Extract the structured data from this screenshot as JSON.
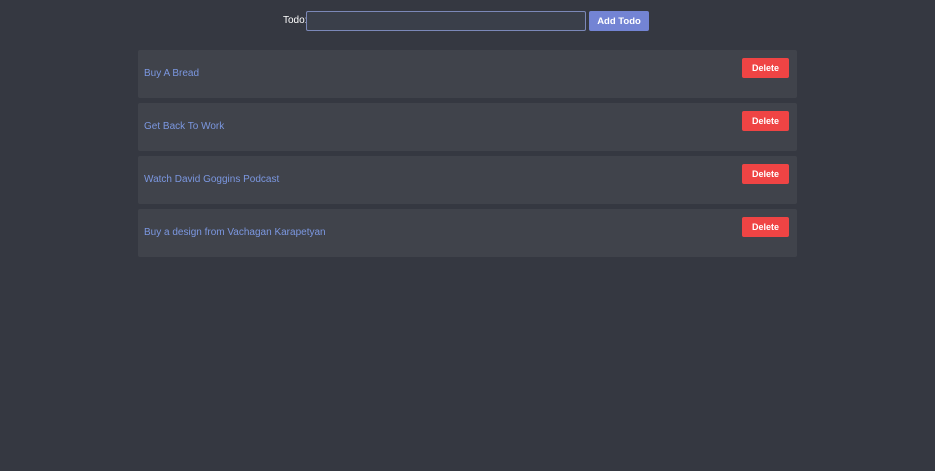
{
  "form": {
    "label": "Todo:",
    "input_value": "",
    "input_placeholder": "",
    "add_button_label": "Add Todo"
  },
  "todos": [
    {
      "text": "Buy A Bread",
      "delete_label": "Delete"
    },
    {
      "text": "Get Back To Work",
      "delete_label": "Delete"
    },
    {
      "text": "Watch David Goggins Podcast",
      "delete_label": "Delete"
    },
    {
      "text": "Buy a design from Vachagan Karapetyan",
      "delete_label": "Delete"
    }
  ],
  "colors": {
    "background": "#353841",
    "card": "#40434b",
    "accent": "#7384d4",
    "todo_text": "#7b97e0",
    "danger": "#ef4444"
  }
}
